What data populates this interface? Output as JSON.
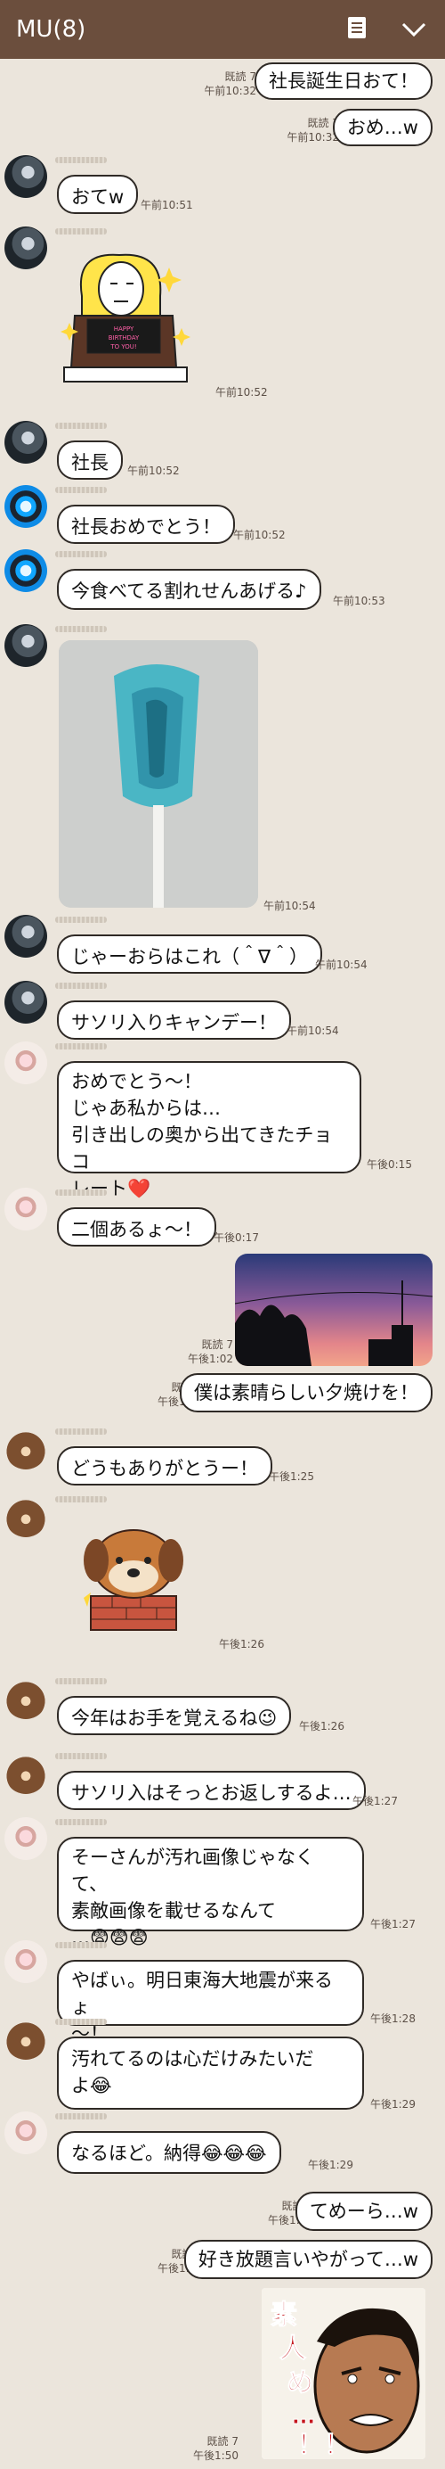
{
  "header": {
    "title": "MU(8)",
    "icons": [
      "memo-icon",
      "chevron-down-icon"
    ]
  },
  "messages": [
    {
      "id": "m1",
      "side": "right",
      "read": "既読 7",
      "time": "午前10:32",
      "text": "社長誕生日おて！"
    },
    {
      "id": "m2",
      "side": "right",
      "read": "既読 7",
      "time": "午前10:32",
      "text": "おめ…w"
    },
    {
      "id": "m3",
      "side": "left",
      "avatar": "dark",
      "time": "午前10:51",
      "text": "おてw"
    },
    {
      "id": "m4",
      "side": "left",
      "avatar": "dark",
      "time": "午前10:52",
      "sticker": "birthday-cake-sticker",
      "sticker_text": "HAPPY BIRTHDAY TO YOU!"
    },
    {
      "id": "m5",
      "side": "left",
      "avatar": "dark",
      "time": "午前10:52",
      "text": "社長"
    },
    {
      "id": "m6",
      "side": "left",
      "avatar": "blue",
      "time": "午前10:52",
      "text": "社長おめでとう！"
    },
    {
      "id": "m7",
      "side": "left",
      "avatar": "blue",
      "time": "午前10:53",
      "text": "今食べてる割れせんあげる♪"
    },
    {
      "id": "m8",
      "side": "left",
      "avatar": "dark",
      "time": "午前10:54",
      "photo": "scorpion-lollipop-photo"
    },
    {
      "id": "m9",
      "side": "left",
      "avatar": "dark",
      "time": "午前10:54",
      "text": "じゃーおらはこれ（＾∇＾）"
    },
    {
      "id": "m10",
      "side": "left",
      "avatar": "dark",
      "time": "午前10:54",
      "text": "サソリ入りキャンデー！"
    },
    {
      "id": "m11",
      "side": "left",
      "avatar": "pink",
      "time": "午後0:15",
      "lines": [
        "おめでとう～！",
        "じゃあ私からは…",
        "引き出しの奥から出てきたチョコ",
        "レート❤️"
      ]
    },
    {
      "id": "m12",
      "side": "left",
      "avatar": "pink",
      "time": "午後0:17",
      "text": "二個あるょ～！"
    },
    {
      "id": "m13",
      "side": "right",
      "read": "既読 7",
      "time": "午後1:02",
      "photo": "sunset-sky-photo"
    },
    {
      "id": "m14",
      "side": "right",
      "read": "既読 7",
      "time": "午後1:02",
      "text": "僕は素晴らしい夕焼けを！"
    },
    {
      "id": "m15",
      "side": "left",
      "avatar": "bear",
      "time": "午後1:25",
      "text": "どうもありがとうー！"
    },
    {
      "id": "m16",
      "side": "left",
      "avatar": "bear",
      "time": "午後1:26",
      "sticker": "dog-sticker"
    },
    {
      "id": "m17",
      "side": "left",
      "avatar": "bear",
      "time": "午後1:26",
      "text": "今年はお手を覚えるね😉"
    },
    {
      "id": "m18",
      "side": "left",
      "avatar": "bear",
      "time": "午後1:27",
      "text": "サソリ入はそっとお返しするよ…"
    },
    {
      "id": "m19",
      "side": "left",
      "avatar": "pink",
      "time": "午後1:27",
      "lines": [
        "そーさんが汚れ画像じゃなくて、",
        "素敵画像を載せるなんて",
        "…😨😨😨"
      ]
    },
    {
      "id": "m20",
      "side": "left",
      "avatar": "pink",
      "time": "午後1:28",
      "lines": [
        "やばぃ。明日東海大地震が来るょ",
        "～！"
      ]
    },
    {
      "id": "m21",
      "side": "left",
      "avatar": "bear",
      "time": "午後1:29",
      "lines": [
        "汚れてるのは心だけみたいだ",
        "よ😂"
      ]
    },
    {
      "id": "m22",
      "side": "left",
      "avatar": "pink",
      "time": "午後1:29",
      "text": "なるほど。納得😂😂😂"
    },
    {
      "id": "m23",
      "side": "right",
      "read": "既読 7",
      "time": "午後1:49",
      "text": "てめーら…w"
    },
    {
      "id": "m24",
      "side": "right",
      "read": "既読 7",
      "time": "午後1:50",
      "text": "好き放題言いやがって…w"
    },
    {
      "id": "m25",
      "side": "right",
      "read": "既読 7",
      "time": "午後1:50",
      "sticker": "manga-shock-sticker",
      "sticker_text": "素人め…！！"
    }
  ]
}
